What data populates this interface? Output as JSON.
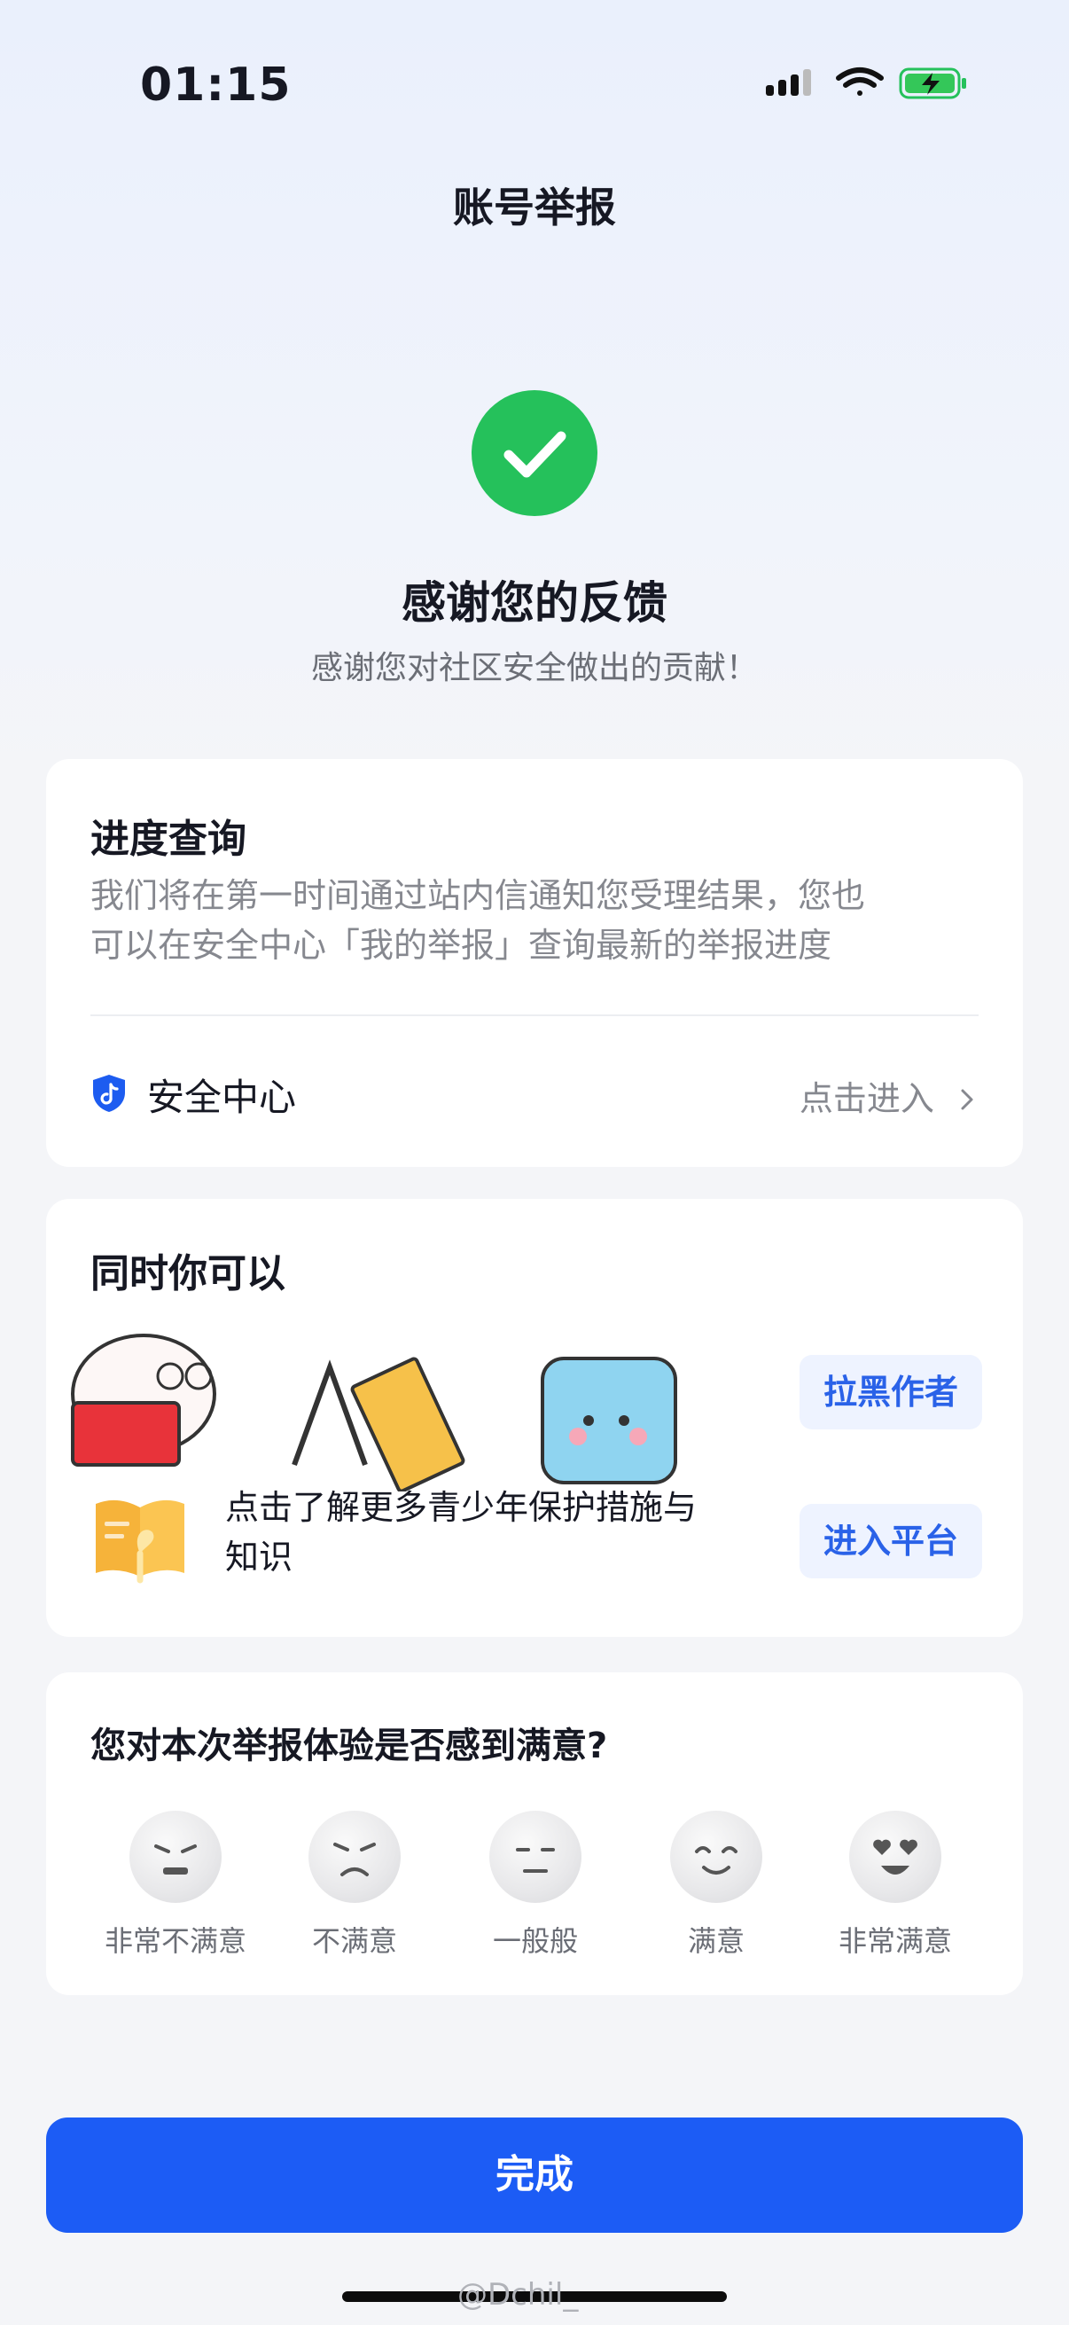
{
  "status_bar": {
    "time": "01:15",
    "battery": "charging",
    "icons": [
      "signal-icon",
      "wifi-icon",
      "battery-charging-icon"
    ]
  },
  "nav": {
    "title": "账号举报"
  },
  "result": {
    "icon": "check-circle-icon",
    "title": "感谢您的反馈",
    "subtitle": "感谢您对社区安全做出的贡献！"
  },
  "progress_card": {
    "title": "进度查询",
    "description_line1": "我们将在第一时间通过站内信通知您受理结果，您也",
    "description_line2": "可以在安全中心「我的举报」查询最新的举报进度",
    "safety_center_label": "安全中心",
    "safety_center_action": "点击进入",
    "chevron": "chevron-right-icon"
  },
  "also_card": {
    "title": "同时你可以",
    "block_author_button": "拉黑作者",
    "youth_text_line1": "点击了解更多青少年保护措施与",
    "youth_text_line2": "知识",
    "enter_platform_button": "进入平台"
  },
  "survey_card": {
    "title": "您对本次举报体验是否感到满意?",
    "options": [
      {
        "label": "非常不满意",
        "icon": "very-unsatisfied-face-icon"
      },
      {
        "label": "不满意",
        "icon": "unsatisfied-face-icon"
      },
      {
        "label": "一般般",
        "icon": "neutral-face-icon"
      },
      {
        "label": "满意",
        "icon": "satisfied-face-icon"
      },
      {
        "label": "非常满意",
        "icon": "very-satisfied-face-icon"
      }
    ]
  },
  "footer": {
    "done_button": "完成",
    "watermark": "@Dchil_"
  },
  "colors": {
    "primary": "#1c5cf5",
    "success": "#25c15b",
    "secondary_text": "#86888f",
    "action_bg": "#eef3ff"
  }
}
